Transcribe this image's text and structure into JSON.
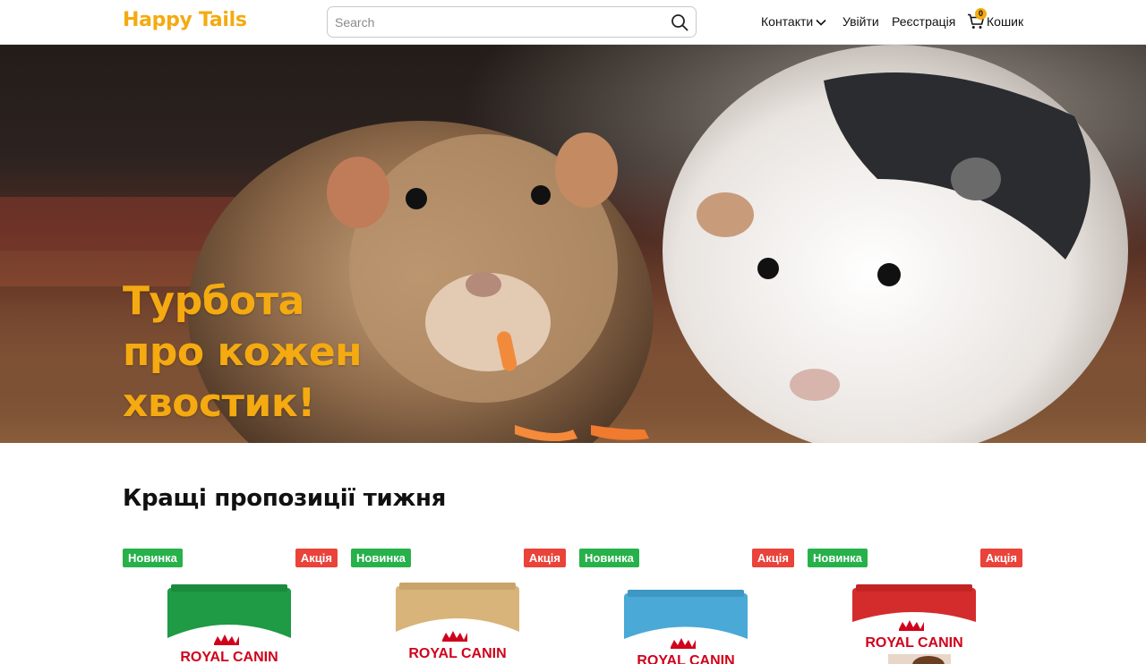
{
  "brand": {
    "name": "Happy Tails",
    "accent": "#f4aa10"
  },
  "header": {
    "search_placeholder": "Search",
    "search_icon": "search-icon",
    "nav": {
      "contacts": "Контакти",
      "login": "Увійти",
      "register": "Реєстрація",
      "cart": "Кошик",
      "cart_count": "0"
    }
  },
  "hero": {
    "title_lines": [
      "Турбота",
      "про кожен",
      "хвостик!"
    ]
  },
  "offers": {
    "title": "Кращі пропозиції тижня",
    "products": [
      {
        "badge_new": "Новинка",
        "badge_sale": "Акція",
        "brand": "ROYAL CANIN",
        "pack_color": "#1f9a45"
      },
      {
        "badge_new": "Новинка",
        "badge_sale": "Акція",
        "brand": "ROYAL CANIN",
        "pack_color": "#d8b47a"
      },
      {
        "badge_new": "Новинка",
        "badge_sale": "Акція",
        "brand": "ROYAL CANIN",
        "pack_color": "#4aa9d6"
      },
      {
        "badge_new": "Новинка",
        "badge_sale": "Акція",
        "brand": "ROYAL CANIN",
        "pack_color": "#d42c2c"
      }
    ]
  },
  "colors": {
    "badge_new": "#27b14b",
    "badge_sale": "#e9433a"
  }
}
